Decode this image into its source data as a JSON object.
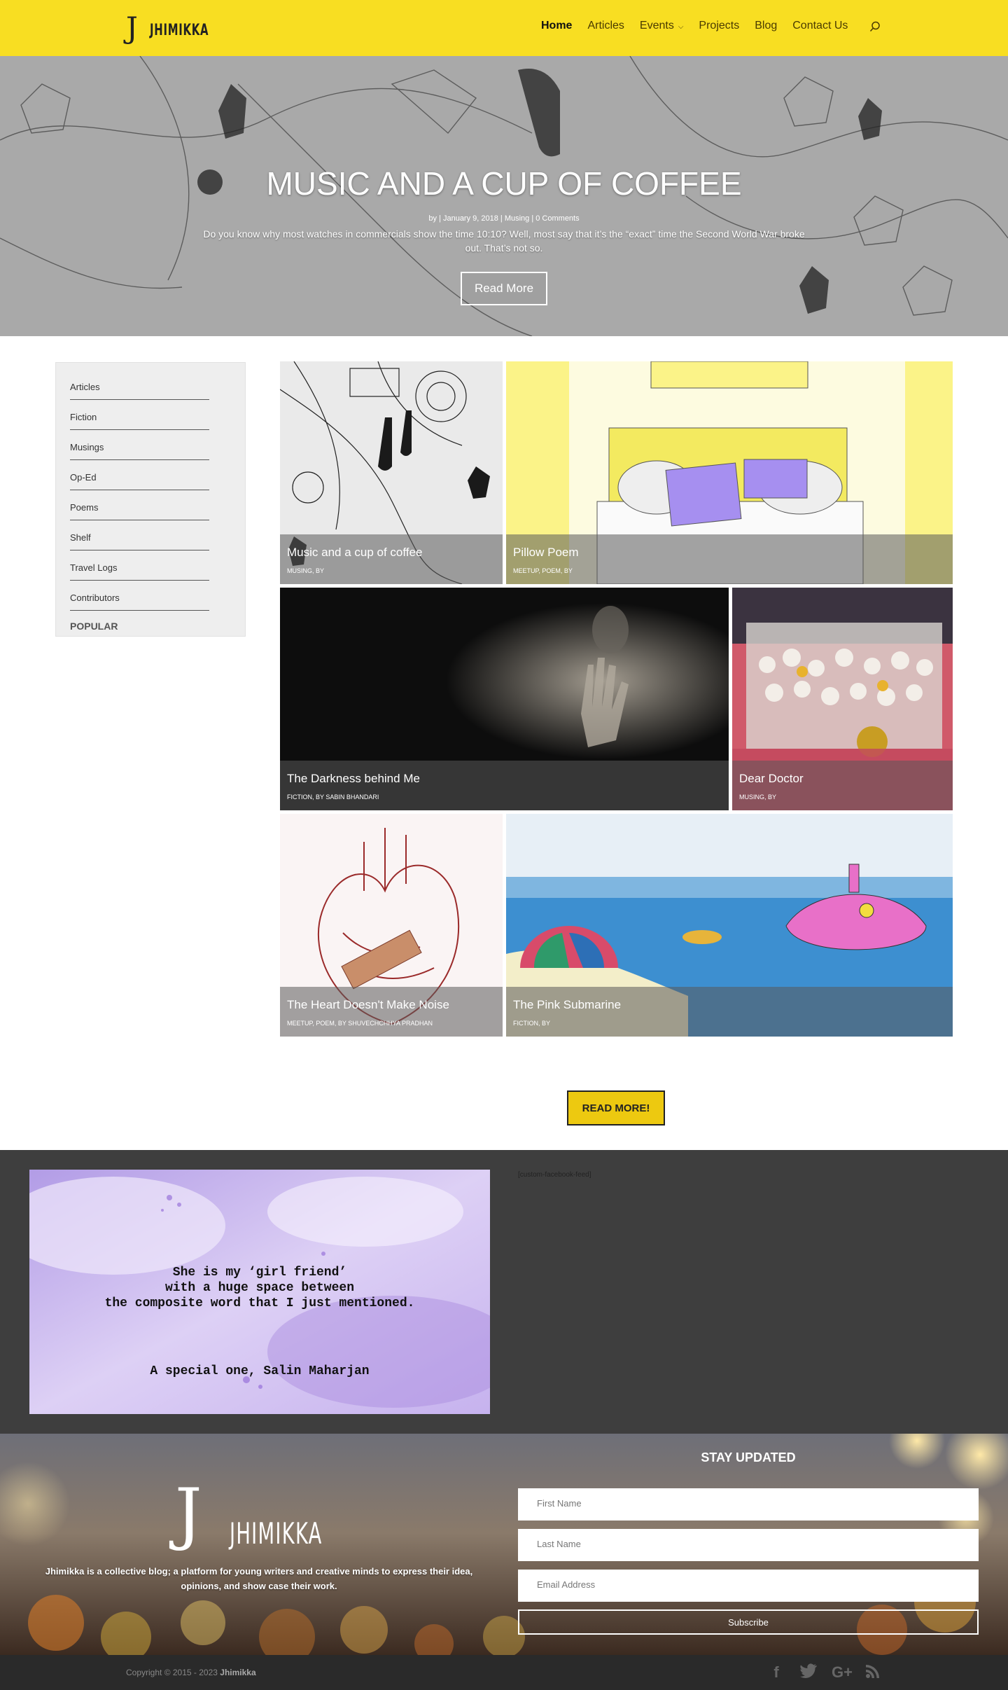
{
  "header": {
    "logo_mark": "J",
    "logo_text": "JHIMIKKA",
    "nav": [
      {
        "label": "Home",
        "active": true
      },
      {
        "label": "Articles"
      },
      {
        "label": "Events",
        "has_dropdown": true
      },
      {
        "label": "Projects"
      },
      {
        "label": "Blog"
      },
      {
        "label": "Contact Us"
      }
    ],
    "search_icon": "search-icon",
    "bg_color": "#f8de22"
  },
  "hero": {
    "title": "MUSIC AND A CUP OF COFFEE",
    "meta": "by | January 9, 2018 | Musing | 0 Comments",
    "excerpt": "Do you know why most watches in commercials show the time 10:10? Well, most say that it’s the “exact” time the Second World War broke out. That’s not so.",
    "button": "Read More"
  },
  "sidebar": {
    "items": [
      "Articles",
      "Fiction",
      "Musings",
      "Op-Ed",
      "Poems",
      "Shelf",
      "Travel Logs",
      "Contributors"
    ],
    "popular": "POPULAR"
  },
  "posts": [
    {
      "title": "Music and a cup of coffee",
      "meta": "MUSING, BY"
    },
    {
      "title": "Pillow Poem",
      "meta": "MEETUP, POEM, BY"
    },
    {
      "title": "The Darkness behind Me",
      "meta": "FICTION, BY SABIN BHANDARI"
    },
    {
      "title": "Dear Doctor",
      "meta": "MUSING, BY"
    },
    {
      "title": "The Heart Doesn't Make Noise",
      "meta": "MEETUP, POEM, BY SHUVECHCHHYA PRADHAN"
    },
    {
      "title": "The Pink Submarine",
      "meta": "FICTION, BY"
    }
  ],
  "read_more": "READ MORE!",
  "quote": {
    "lines": [
      "She is my ‘girl friend’",
      "with a huge space between",
      "the composite word that I just mentioned."
    ],
    "author": "A special one, Salin Maharjan"
  },
  "facebook_feed": "[custom-facebook-feed]",
  "footer": {
    "logo_mark": "J",
    "logo_text": "JHIMIKKA",
    "description": "Jhimikka is a collective blog; a platform for young writers and creative minds to express their idea, opinions, and show case their work.",
    "stay_updated": "STAY UPDATED",
    "first_name_placeholder": "First Name",
    "last_name_placeholder": "Last Name",
    "email_placeholder": "Email Address",
    "subscribe": "Subscribe",
    "copyright_prefix": "Copyright © 2015 - 2023 ",
    "copyright_brand": "Jhimikka",
    "social_icons": [
      "facebook-icon",
      "twitter-icon",
      "google-plus-icon",
      "rss-icon"
    ]
  }
}
